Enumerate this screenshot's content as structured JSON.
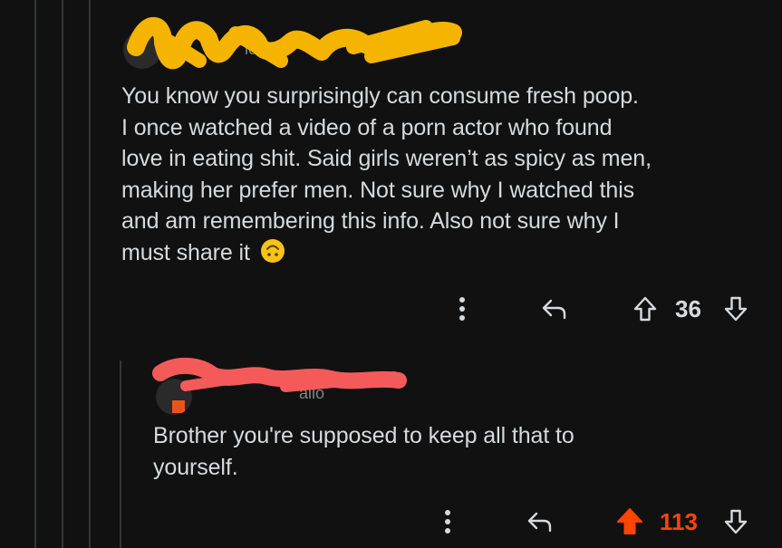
{
  "thread": {
    "comment": {
      "username": "ich",
      "body_lines": [
        "You know you surprisingly can consume fresh poop.",
        "I once watched a video of a porn actor who found",
        "love in eating shit. Said girls weren’t as spicy as men,",
        "making her prefer men. Not sure why I watched this",
        "and am remembering this info. Also not sure why I",
        "must share it"
      ],
      "vote_count": "36",
      "emoji": "upside-down-face-icon"
    },
    "reply": {
      "username": "allo",
      "body_lines": [
        "Brother you're supposed to keep all that to",
        "yourself."
      ],
      "vote_count": "113",
      "upvoted": true
    }
  },
  "colors": {
    "background": "#111111",
    "text": "#d7dadc",
    "muted": "#818384",
    "thread_line": "#343536",
    "upvote_active": "#ff4500",
    "redact_yellow": "#f4b400",
    "redact_red": "#f55a5a"
  }
}
